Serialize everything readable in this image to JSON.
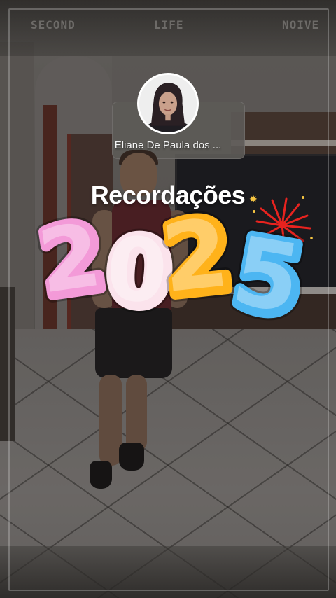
{
  "header": {
    "words": [
      "SECOND",
      "LIFE",
      "NOIVE"
    ]
  },
  "profile": {
    "name": "Eliane De Paula dos ...",
    "avatar_icon": "avatar-photo"
  },
  "story": {
    "title": "Recordações",
    "year_digits": [
      "2",
      "0",
      "2",
      "5"
    ],
    "year_colors": [
      "#f39ad8",
      "#fbe3ec",
      "#ffb21a",
      "#4cb6f2"
    ],
    "sparkle_icon": "sparkle-icon",
    "fireworks_icon": "fireworks-icon"
  }
}
